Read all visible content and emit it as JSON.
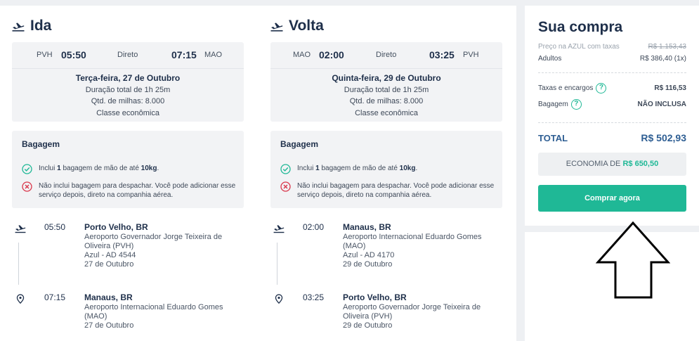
{
  "outbound": {
    "title": "Ida",
    "origin_code": "PVH",
    "departure_time": "05:50",
    "flight_type": "Direto",
    "arrival_time": "07:15",
    "dest_code": "MAO",
    "date": "Terça-feira, 27 de Outubro",
    "duration": "Duração total de 1h 25m",
    "miles": "Qtd. de milhas: 8.000",
    "class": "Classe econômica",
    "baggage": {
      "title": "Bagagem",
      "carry_pre": "Inclui ",
      "carry_qty": "1",
      "carry_mid": " bagagem de mão de até ",
      "carry_weight": "10kg",
      "carry_post": ".",
      "checked": "Não inclui bagagem para despachar. Você pode adicionar esse serviço depois, direto na companhia aérea."
    },
    "legs": [
      {
        "time": "05:50",
        "city": "Porto Velho, BR",
        "airport": "Aeroporto Governador Jorge Teixeira de Oliveira (PVH)",
        "flight": "Azul - AD 4544",
        "date": "27 de Outubro"
      },
      {
        "time": "07:15",
        "city": "Manaus, BR",
        "airport": "Aeroporto Internacional Eduardo Gomes (MAO)",
        "date": "27 de Outubro"
      }
    ]
  },
  "inbound": {
    "title": "Volta",
    "origin_code": "MAO",
    "departure_time": "02:00",
    "flight_type": "Direto",
    "arrival_time": "03:25",
    "dest_code": "PVH",
    "date": "Quinta-feira, 29 de Outubro",
    "duration": "Duração total de 1h 25m",
    "miles": "Qtd. de milhas: 8.000",
    "class": "Classe econômica",
    "baggage": {
      "title": "Bagagem",
      "carry_pre": "Inclui ",
      "carry_qty": "1",
      "carry_mid": " bagagem de mão de até ",
      "carry_weight": "10kg",
      "carry_post": ".",
      "checked": "Não inclui bagagem para despachar. Você pode adicionar esse serviço depois, direto na companhia aérea."
    },
    "legs": [
      {
        "time": "02:00",
        "city": "Manaus, BR",
        "airport": "Aeroporto Internacional Eduardo Gomes (MAO)",
        "flight": "Azul - AD 4170",
        "date": "29 de Outubro"
      },
      {
        "time": "03:25",
        "city": "Porto Velho, BR",
        "airport": "Aeroporto Governador Jorge Teixeira de Oliveira (PVH)",
        "date": "29 de Outubro"
      }
    ]
  },
  "purchase": {
    "title": "Sua compra",
    "airline_price_label": "Preço na AZUL com taxas",
    "airline_price": "R$ 1.153,43",
    "adults_label": "Adultos",
    "adults_value": "R$ 386,40 (1x)",
    "taxes_label": "Taxas e encargos",
    "taxes_value": "R$ 116,53",
    "baggage_label": "Bagagem",
    "baggage_value": "NÃO INCLUSA",
    "help_glyph": "?",
    "total_label": "TOTAL",
    "total_value": "R$ 502,93",
    "savings_label": "ECONOMIA DE ",
    "savings_value": "R$ 650,50",
    "buy_button": "Comprar agora"
  },
  "colors": {
    "accent": "#1fb896",
    "total": "#2e5e93",
    "error": "#d9364a",
    "heading": "#1e2f4a"
  },
  "icons": [
    "airplane-takeoff-icon",
    "check-circle-icon",
    "x-circle-icon",
    "location-pin-icon",
    "help-circle-icon",
    "up-arrow-annotation"
  ]
}
